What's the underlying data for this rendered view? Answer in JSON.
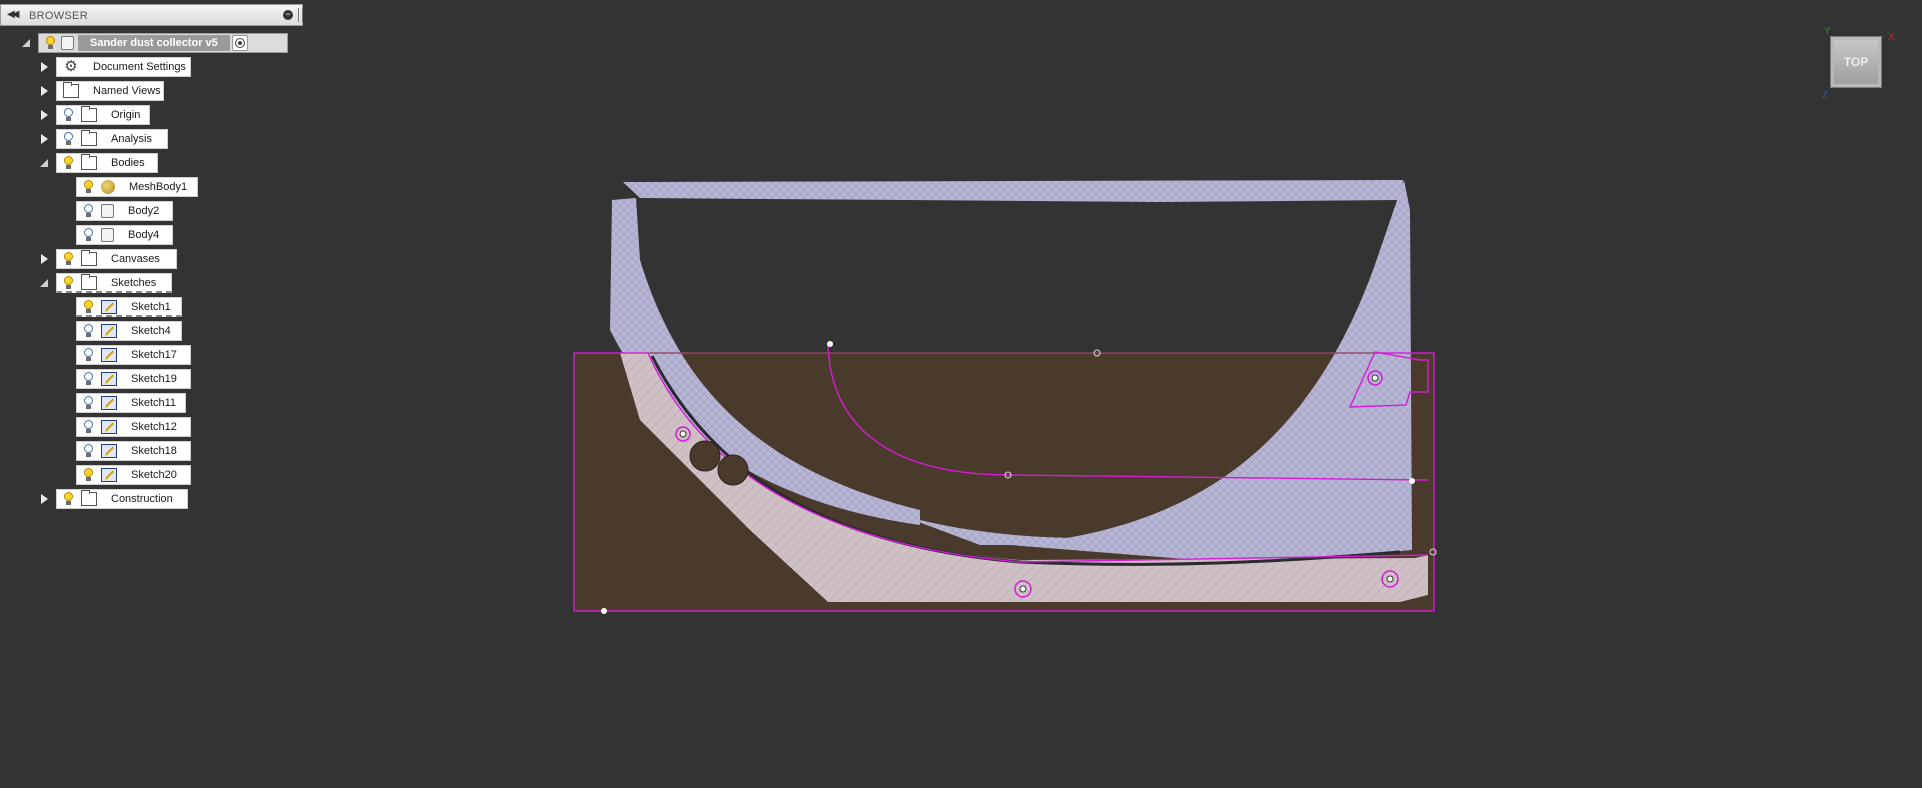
{
  "browser": {
    "title": "BROWSER",
    "collapse_icon": "double-left-arrow",
    "root": {
      "label": "Sander dust collector v5",
      "visible": true
    },
    "items": [
      {
        "label": "Document Settings",
        "icon": "gear-icon",
        "expander": "collapsed",
        "bulb": "none"
      },
      {
        "label": "Named Views",
        "icon": "folder-icon",
        "expander": "collapsed",
        "bulb": "none"
      },
      {
        "label": "Origin",
        "icon": "folder-icon",
        "expander": "collapsed",
        "bulb": "off"
      },
      {
        "label": "Analysis",
        "icon": "folder-icon",
        "expander": "collapsed",
        "bulb": "off"
      },
      {
        "label": "Bodies",
        "icon": "folder-icon",
        "expander": "expanded",
        "bulb": "on"
      },
      {
        "label": "Canvases",
        "icon": "folder-icon",
        "expander": "collapsed",
        "bulb": "on"
      },
      {
        "label": "Sketches",
        "icon": "folder-icon",
        "expander": "expanded",
        "bulb": "on"
      },
      {
        "label": "Construction",
        "icon": "folder-icon",
        "expander": "collapsed",
        "bulb": "on"
      }
    ],
    "bodies": [
      {
        "label": "MeshBody1",
        "icon": "mesh-body-icon",
        "bulb": "on"
      },
      {
        "label": "Body2",
        "icon": "body-icon",
        "bulb": "off"
      },
      {
        "label": "Body4",
        "icon": "body-icon",
        "bulb": "off"
      }
    ],
    "sketches": [
      {
        "label": "Sketch1",
        "bulb": "on"
      },
      {
        "label": "Sketch4",
        "bulb": "off"
      },
      {
        "label": "Sketch17",
        "bulb": "off"
      },
      {
        "label": "Sketch19",
        "bulb": "off"
      },
      {
        "label": "Sketch11",
        "bulb": "off"
      },
      {
        "label": "Sketch12",
        "bulb": "off"
      },
      {
        "label": "Sketch18",
        "bulb": "off"
      },
      {
        "label": "Sketch20",
        "bulb": "on"
      }
    ]
  },
  "viewcube": {
    "face": "TOP",
    "axis_x": "X",
    "axis_y": "Y",
    "axis_z": "Z"
  },
  "colors": {
    "background": "#333333",
    "mesh": "#b9b7d6",
    "sketch_profile": "#d81ad8",
    "canvas_wood": "#4a3a2b",
    "panel": "#ffffff"
  }
}
